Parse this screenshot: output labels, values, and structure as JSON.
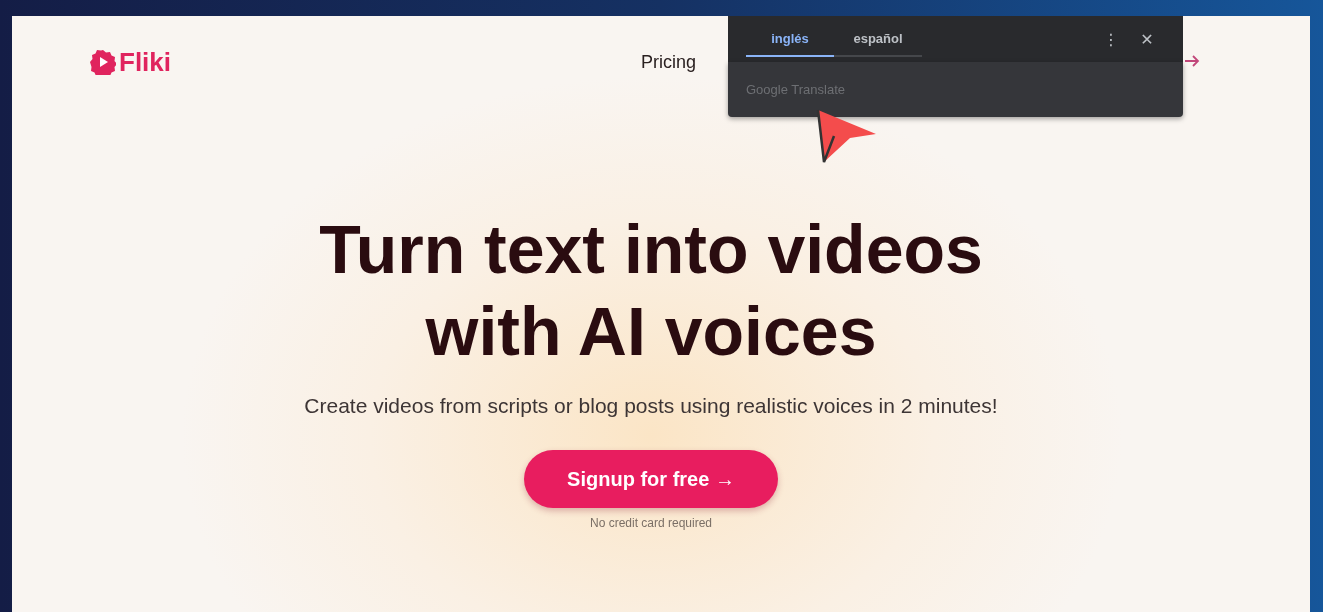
{
  "brand": {
    "name": "Fliki"
  },
  "nav": {
    "links": [
      "Pricing"
    ]
  },
  "hero": {
    "title_lines": [
      "Turn text into videos",
      "with AI voices"
    ],
    "subtitle": "Create videos from scripts or blog posts using realistic voices in 2 minutes!",
    "cta": "Signup for free →",
    "cta_note": "No credit card required"
  },
  "translate_popup": {
    "tabs": [
      {
        "label": "inglés",
        "selected": true
      },
      {
        "label": "español",
        "selected": false
      }
    ],
    "more": "⋮",
    "close": "✕",
    "placeholder": "Google Translate"
  }
}
